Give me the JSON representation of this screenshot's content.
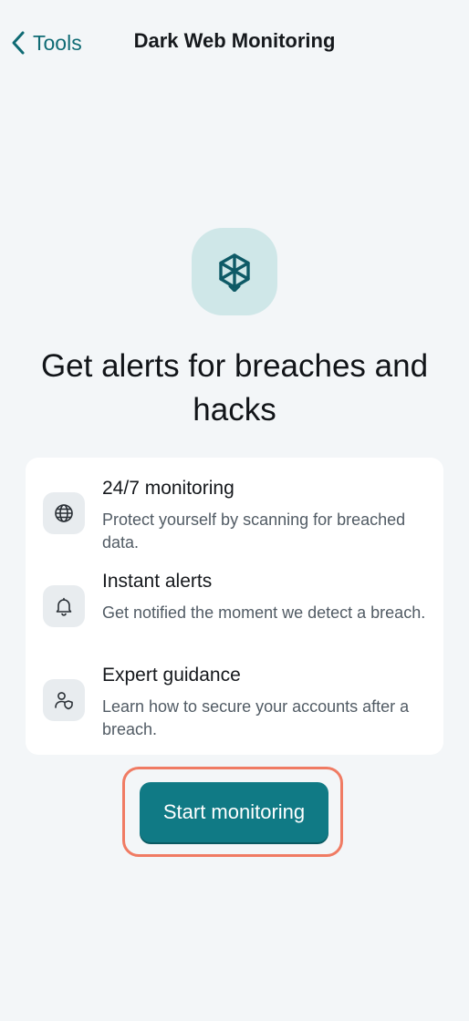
{
  "header": {
    "back_label": "Tools",
    "title": "Dark Web Monitoring"
  },
  "hero": {
    "icon": "cube-shield-icon",
    "headline": "Get alerts for breaches and hacks"
  },
  "features": [
    {
      "icon": "globe-icon",
      "title": "24/7 monitoring",
      "description": "Protect yourself by scanning for breached data."
    },
    {
      "icon": "bell-icon",
      "title": "Instant alerts",
      "description": "Get notified the moment we detect a breach."
    },
    {
      "icon": "user-shield-icon",
      "title": "Expert guidance",
      "description": "Learn how to secure your accounts after a breach."
    }
  ],
  "cta": {
    "label": "Start monitoring"
  },
  "colors": {
    "background": "#f3f6f8",
    "accent": "#107a85",
    "highlight_outline": "#f07b63",
    "hero_icon_bg": "#cfe7e8"
  }
}
